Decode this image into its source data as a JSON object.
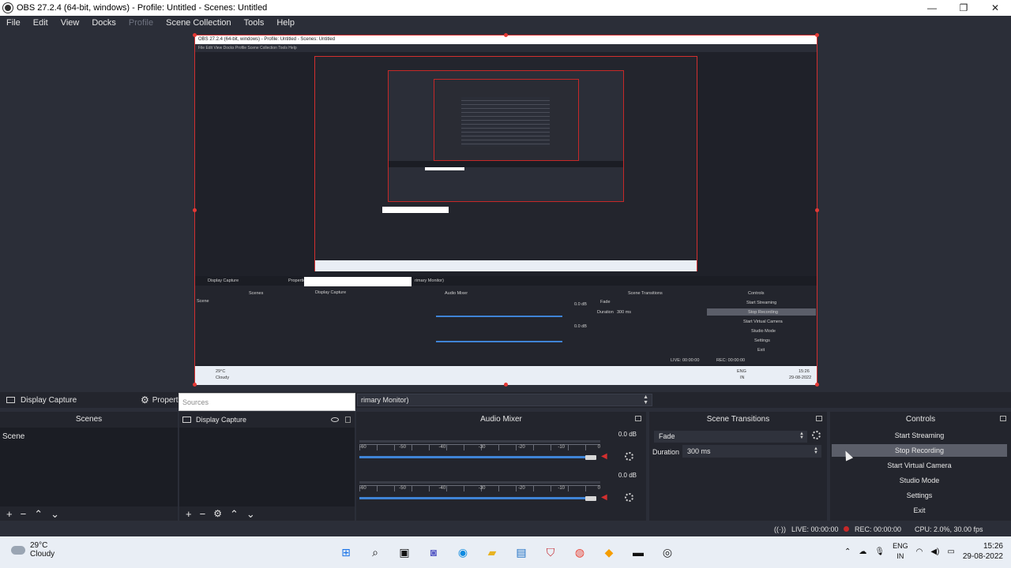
{
  "window": {
    "title": "OBS 27.2.4 (64-bit, windows) - Profile: Untitled - Scenes: Untitled",
    "minimize": "—",
    "restore": "❐",
    "close": "✕"
  },
  "menu": {
    "file": "File",
    "edit": "Edit",
    "view": "View",
    "docks": "Docks",
    "profile": "Profile",
    "scene_collection": "Scene Collection",
    "tools": "Tools",
    "help": "Help"
  },
  "nested": {
    "title": "OBS 27.2.4 (64-bit, windows) - Profile: Untitled - Scenes: Untitled",
    "menu": "File   Edit   View   Docks   Profile   Scene Collection   Tools   Help",
    "source_name": "Display Capture",
    "properties": "Properties",
    "monitor": "rimary Monitor)",
    "scenes": "Scenes",
    "scene": "Scene",
    "audio_mixer": "Audio Mixer",
    "scene_transitions": "Scene Transitions",
    "controls": "Controls",
    "fade": "Fade",
    "duration": "Duration",
    "duration_value": "300 ms",
    "start_streaming": "Start Streaming",
    "stop_recording": "Stop Recording",
    "start_virtual_camera": "Start Virtual Camera",
    "studio_mode": "Studio Mode",
    "settings": "Settings",
    "exit": "Exit",
    "db": "0.0 dB",
    "temp": "29°C",
    "weather": "Cloudy",
    "live": "LIVE: 00:00:00",
    "rec": "REC: 00:00:00",
    "lang": "ENG",
    "lang2": "IN",
    "time": "15:26",
    "date": "29-08-2022"
  },
  "source_toolbar": {
    "source_name": "Display Capture",
    "properties": "Propertie",
    "monitor": "rimary Monitor)"
  },
  "sources_popup": {
    "placeholder": "Sources"
  },
  "scenes_dock": {
    "title": "Scenes",
    "items": [
      "Scene"
    ]
  },
  "sources_dock": {
    "items": [
      "Display Capture"
    ]
  },
  "audio_mixer": {
    "title": "Audio Mixer",
    "tracks": [
      {
        "db": "0.0 dB",
        "volume_fraction": 0.98
      },
      {
        "db": "0.0 dB",
        "volume_fraction": 0.98
      }
    ],
    "tick_labels": [
      "-60",
      "-55",
      "-50",
      "-45",
      "-40",
      "-35",
      "-30",
      "-25",
      "-20",
      "-15",
      "-10",
      "-5",
      "0"
    ]
  },
  "scene_transitions": {
    "title": "Scene Transitions",
    "transition": "Fade",
    "duration_label": "Duration",
    "duration_value": "300 ms"
  },
  "controls": {
    "title": "Controls",
    "start_streaming": "Start Streaming",
    "stop_recording": "Stop Recording",
    "start_virtual_camera": "Start Virtual Camera",
    "studio_mode": "Studio Mode",
    "settings": "Settings",
    "exit": "Exit"
  },
  "status": {
    "live": "LIVE: 00:00:00",
    "rec": "REC: 00:00:00",
    "cpu": "CPU: 2.0%, 30.00 fps"
  },
  "taskbar": {
    "temperature": "29°C",
    "weather": "Cloudy",
    "language": "ENG",
    "region": "IN",
    "time": "15:26",
    "date": "29-08-2022"
  },
  "colors": {
    "background": "#2b2e38",
    "dock": "#23252d",
    "accent_red": "#d32f2f",
    "slider_blue": "#3f84d6"
  }
}
